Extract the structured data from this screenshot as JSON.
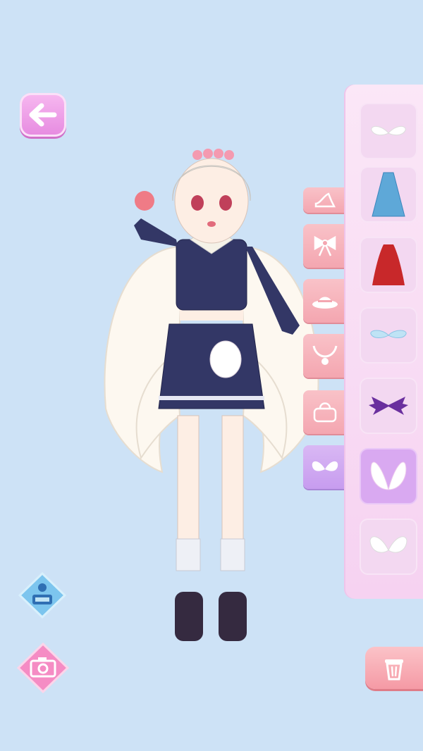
{
  "colors": {
    "background": "#cde2f6",
    "panel": "#f8dcf4",
    "tab": "#f7b3bb",
    "tab_active": "#cfa6f2",
    "slot_selected": "#d9a9f1",
    "back_button": "#ee9fe8"
  },
  "toolbar": {
    "back_icon": "arrow-left-icon"
  },
  "categories": [
    {
      "icon": "high-heel-icon",
      "active": false
    },
    {
      "icon": "bow-icon",
      "active": false
    },
    {
      "icon": "hat-icon",
      "active": false
    },
    {
      "icon": "necklace-icon",
      "active": false
    },
    {
      "icon": "handbag-icon",
      "active": false
    },
    {
      "icon": "wings-icon",
      "active": true
    }
  ],
  "items": [
    {
      "icon": "small-white-wings-icon",
      "selected": false
    },
    {
      "icon": "blue-cape-icon",
      "selected": false
    },
    {
      "icon": "red-cape-icon",
      "selected": false
    },
    {
      "icon": "blue-small-wings-icon",
      "selected": false
    },
    {
      "icon": "purple-bat-wings-icon",
      "selected": false
    },
    {
      "icon": "white-angel-wings-icon",
      "selected": true
    },
    {
      "icon": "white-fluffy-wings-icon",
      "selected": false
    }
  ],
  "bottom_controls": {
    "avatar_icon": "avatar-figure-icon",
    "camera_icon": "camera-icon",
    "trash_icon": "trash-can-icon"
  }
}
